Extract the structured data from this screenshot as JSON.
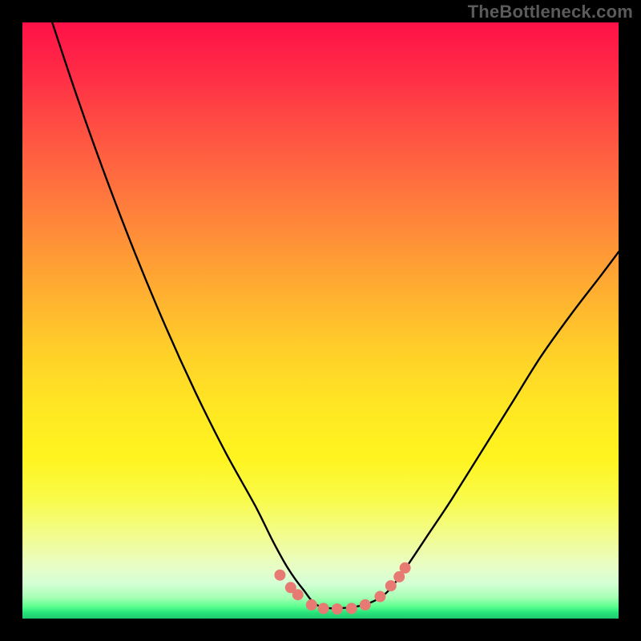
{
  "watermark": "TheBottleneck.com",
  "chart_data": {
    "type": "line",
    "title": "",
    "xlabel": "",
    "ylabel": "",
    "xlim": [
      0,
      1
    ],
    "ylim": [
      0,
      1
    ],
    "series": [
      {
        "name": "bottleneck-curve",
        "color": "#000000",
        "x": [
          0.05,
          0.09,
          0.14,
          0.19,
          0.24,
          0.29,
          0.34,
          0.39,
          0.42,
          0.445,
          0.47,
          0.5,
          0.56,
          0.6,
          0.625,
          0.65,
          0.68,
          0.72,
          0.77,
          0.82,
          0.87,
          0.92,
          0.97,
          1.0
        ],
        "y": [
          1.0,
          0.88,
          0.74,
          0.61,
          0.49,
          0.38,
          0.28,
          0.19,
          0.13,
          0.085,
          0.05,
          0.02,
          0.02,
          0.035,
          0.06,
          0.095,
          0.14,
          0.2,
          0.28,
          0.36,
          0.44,
          0.51,
          0.575,
          0.615
        ]
      }
    ],
    "markers": {
      "name": "trough-dots",
      "color": "#e77a72",
      "points": [
        {
          "x": 0.432,
          "y": 0.073
        },
        {
          "x": 0.45,
          "y": 0.052
        },
        {
          "x": 0.462,
          "y": 0.04
        },
        {
          "x": 0.485,
          "y": 0.023
        },
        {
          "x": 0.505,
          "y": 0.017
        },
        {
          "x": 0.528,
          "y": 0.016
        },
        {
          "x": 0.552,
          "y": 0.017
        },
        {
          "x": 0.575,
          "y": 0.023
        },
        {
          "x": 0.6,
          "y": 0.037
        },
        {
          "x": 0.618,
          "y": 0.055
        },
        {
          "x": 0.632,
          "y": 0.07
        },
        {
          "x": 0.642,
          "y": 0.085
        }
      ]
    }
  }
}
